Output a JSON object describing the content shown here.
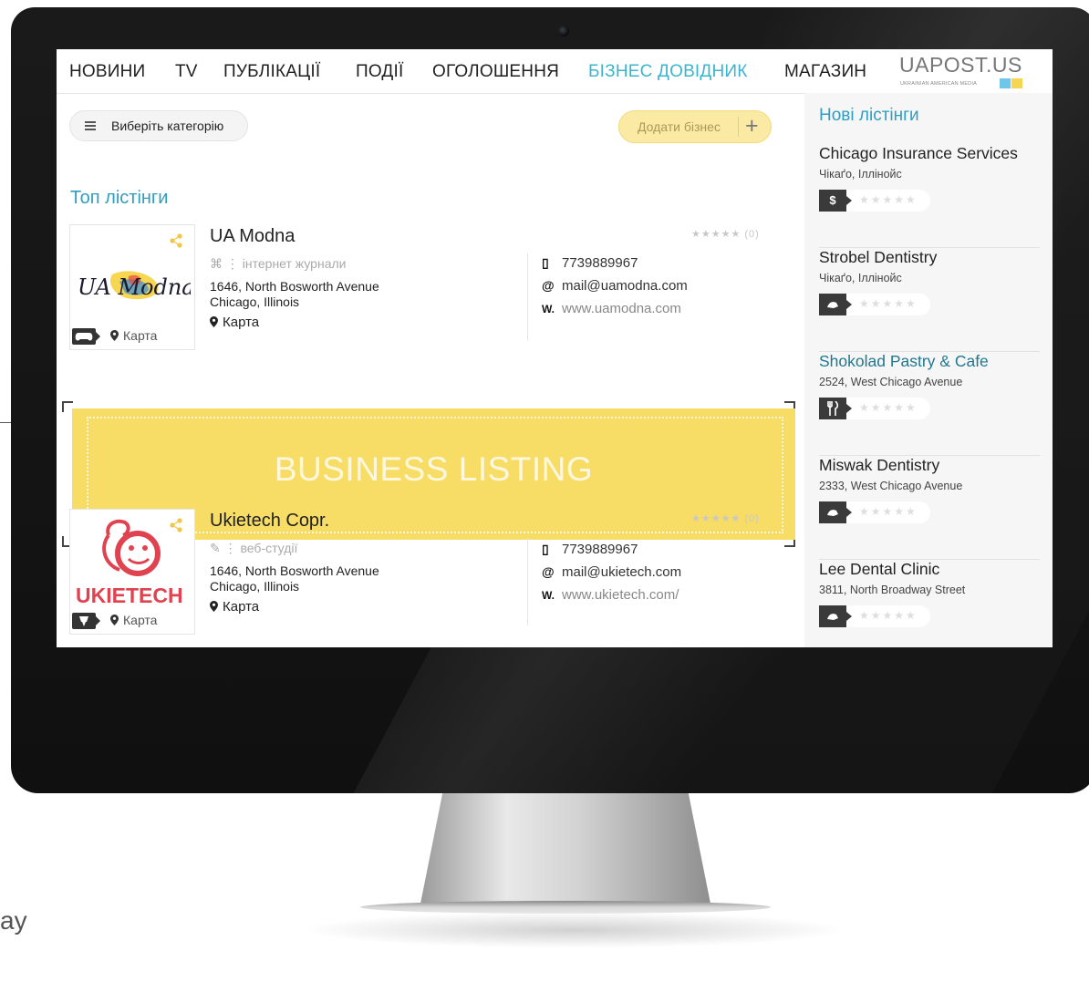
{
  "nav": {
    "items": [
      "НОВИНИ",
      "TV",
      "ПУБЛІКАЦІЇ",
      "ПОДІЇ",
      "ОГОЛОШЕННЯ",
      "БІЗНЕС ДОВІДНИК",
      "МАГАЗИН"
    ],
    "active": "БІЗНЕС ДОВІДНИК",
    "logo": "UAPOST.US",
    "logo_sub": "UKRAINIAN AMERICAN MEDIA"
  },
  "toolbar": {
    "category_label": "Виберіть категорію",
    "add_business_label": "Додати бізнес",
    "add_icon": "+"
  },
  "main": {
    "section_title": "Топ лістінги",
    "listings": [
      {
        "title": "UA Modna",
        "logo_text": "UA Modna",
        "category": "інтернет журнали",
        "address_line1": "1646, North Bosworth Avenue",
        "address_line2": "Chicago, Illinois",
        "map": "Карта",
        "rating": "★★★★★ (0)",
        "phone": "7739889967",
        "email": "mail@uamodna.com",
        "website": "www.uamodna.com",
        "phone_icon": "phone-icon",
        "email_icon": "at-icon",
        "web_icon": "W."
      },
      {
        "title": "Ukietech Copr.",
        "logo_text": "UKIETECH",
        "category": "веб-студії",
        "address_line1": "1646, North Bosworth Avenue",
        "address_line2": "Chicago, Illinois",
        "map": "Карта",
        "rating": "★★★★★ (0)",
        "phone": "7739889967",
        "email": "mail@ukietech.com",
        "website": "www.ukietech.com/",
        "phone_icon": "phone-icon",
        "email_icon": "at-icon",
        "web_icon": "W."
      }
    ],
    "banner_text": "BUSINESS LISTING"
  },
  "sidebar": {
    "title": "Нові лістінги",
    "items": [
      {
        "name": "Chicago Insurance Services",
        "sub": "Чікаґо, Іллінойс",
        "tag": "$",
        "icon": "dollar-icon"
      },
      {
        "name": "Strobel Dentistry",
        "sub": "Чікаґо, Іллінойс",
        "tag": "",
        "icon": "dental-icon"
      },
      {
        "name": "Shokolad Pastry & Cafe",
        "sub": "2524, West Chicago Avenue",
        "tag": "",
        "icon": "cutlery-icon"
      },
      {
        "name": "Miswak Dentistry",
        "sub": "2333, West Chicago Avenue",
        "tag": "",
        "icon": "dental-icon"
      },
      {
        "name": "Lee Dental Clinic",
        "sub": "3811, North Broadway Street",
        "tag": "",
        "icon": "dental-icon"
      }
    ],
    "stars": "★★★★★"
  },
  "page": {
    "side_text": "ay"
  },
  "colors": {
    "accent": "#3cb4cf",
    "banner": "#f7dc66",
    "add_button": "#fbeaa3"
  }
}
